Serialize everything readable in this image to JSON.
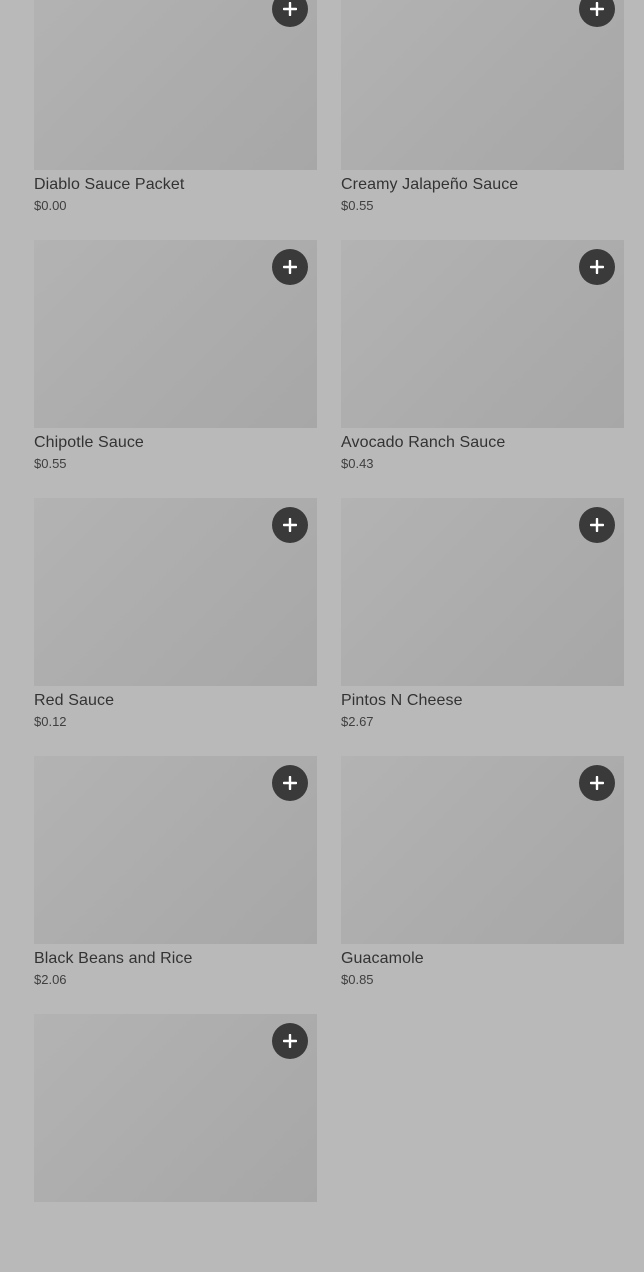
{
  "menu": {
    "items": [
      {
        "name": "Diablo Sauce Packet",
        "price": "$0.00",
        "add_icon": "plus-icon"
      },
      {
        "name": "Creamy Jalapeño Sauce",
        "price": "$0.55",
        "add_icon": "plus-icon"
      },
      {
        "name": "Chipotle Sauce",
        "price": "$0.55",
        "add_icon": "plus-icon"
      },
      {
        "name": "Avocado Ranch Sauce",
        "price": "$0.43",
        "add_icon": "plus-icon"
      },
      {
        "name": "Red Sauce",
        "price": "$0.12",
        "add_icon": "plus-icon"
      },
      {
        "name": "Pintos N Cheese",
        "price": "$2.67",
        "add_icon": "plus-icon"
      },
      {
        "name": "Black Beans and Rice",
        "price": "$2.06",
        "add_icon": "plus-icon"
      },
      {
        "name": "Guacamole",
        "price": "$0.85",
        "add_icon": "plus-icon"
      },
      {
        "name": "",
        "price": "",
        "add_icon": "plus-icon"
      }
    ]
  },
  "colors": {
    "background": "#b9b9b9",
    "card_image": "#adadad",
    "add_button": "#3a3a3a",
    "text": "#333333"
  }
}
